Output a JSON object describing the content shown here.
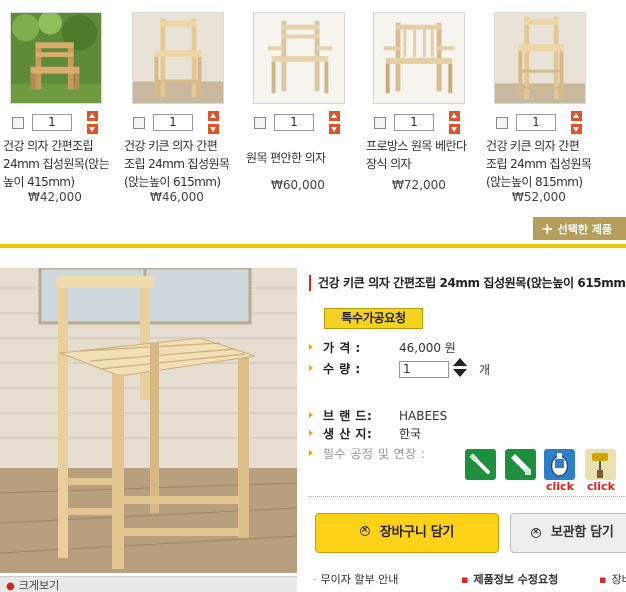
{
  "products": [
    {
      "name": "건강 의자 간편조립\n24mm 집성원목(앉는\n높이 415mm)",
      "price": "₩42,000",
      "qty": "1"
    },
    {
      "name": "건강 키큰 의자 간편\n조립 24mm 집성원목\n(앉는높이 615mm)",
      "price": "₩46,000",
      "qty": "1"
    },
    {
      "name": "원목 편안한 의자",
      "price": "₩60,000",
      "qty": "1"
    },
    {
      "name": "프로방스 원목 베란다\n장식 의자",
      "price": "₩72,000",
      "qty": "1"
    },
    {
      "name": "건강 키큰 의자 간편\n조립 24mm 집성원목\n(앉는높이 815mm)",
      "price": "₩52,000",
      "qty": "1"
    }
  ],
  "selected_button": {
    "plus": "+",
    "label": "선택한 제품"
  },
  "zoom": {
    "mark": "●",
    "label": "크게보기"
  },
  "detail": {
    "title": "건강 키큰 의자 간편조립 24mm 집성원목(앉는높이 615mm)",
    "special_button": "특수가공요청",
    "price_label": "가   격 :",
    "price_value": "46,000 원",
    "qty_label": "수   량 :",
    "qty_value": "1",
    "qty_unit": "개",
    "brand_label": "브 랜 드:",
    "brand_value": "HABEES",
    "origin_label": "생 산 지:",
    "origin_value": "한국",
    "tools_label": "필수 공정 및 연장 :",
    "click1": "click",
    "click2": "click",
    "tool_icons": [
      "screwdriver-icon",
      "saw-icon",
      "glue-icon",
      "paint-roller-icon"
    ]
  },
  "buttons": {
    "cart": "장바구니 담기",
    "keep": "보관함 담기"
  },
  "links": {
    "installment": "무이자 할부 안내",
    "edit_info": "제품정보 수정요청",
    "third": "장바"
  },
  "colors": {
    "accent_gold": "#e5c800",
    "cart_yellow": "#ffd21a",
    "arrow_orange": "#e0522b",
    "click_red": "#e0201a"
  }
}
